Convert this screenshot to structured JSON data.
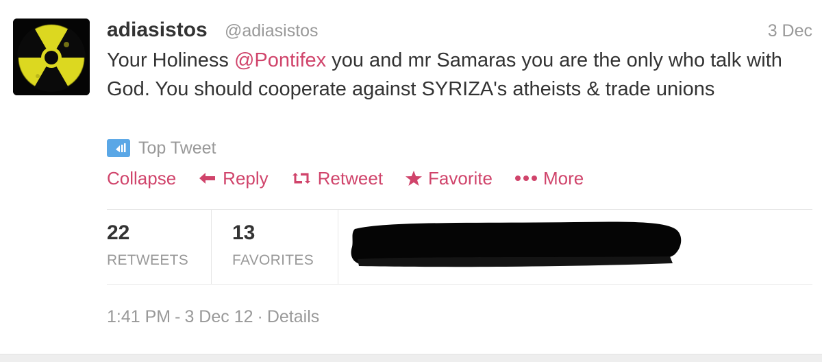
{
  "tweet": {
    "fullname": "adiasistos",
    "username": "@adiasistos",
    "timestamp": "3 Dec",
    "text_before": "Your Holiness ",
    "mention": "@Pontifex",
    "text_after": " you and mr Samaras you are the only who talk with God. You should cooperate against SYRIZA's atheists & trade unions",
    "top_tweet_label": "Top Tweet"
  },
  "actions": {
    "collapse": "Collapse",
    "reply": "Reply",
    "retweet": "Retweet",
    "favorite": "Favorite",
    "more": "More"
  },
  "stats": {
    "retweets_count": "22",
    "retweets_label": "RETWEETS",
    "favorites_count": "13",
    "favorites_label": "FAVORITES"
  },
  "footer": {
    "time": "1:41 PM",
    "date": "3 Dec 12",
    "details": "Details"
  },
  "icons": {
    "avatar": "radiation-symbol-icon",
    "top_tweet": "top-tweet-badge-icon",
    "reply": "reply-arrow-icon",
    "retweet": "retweet-arrows-icon",
    "favorite": "star-icon",
    "more": "dots-icon"
  },
  "colors": {
    "accent": "#d0446b",
    "muted": "#999999",
    "text": "#333333",
    "top_tweet_badge": "#5aa7e6",
    "avatar_yellow": "#e8e61a"
  }
}
